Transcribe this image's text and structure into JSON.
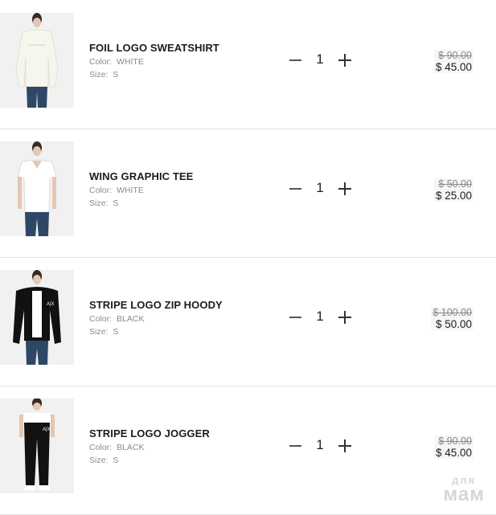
{
  "cart": {
    "items": [
      {
        "name": "FOIL LOGO SWEATSHIRT",
        "color_label": "Color:",
        "color": "WHITE",
        "size_label": "Size:",
        "size": "S",
        "quantity": "1",
        "price_original": "$ 90.00",
        "price_sale": "$ 45.00",
        "image_icon": "white-sweatshirt-model-image"
      },
      {
        "name": "WING GRAPHIC TEE",
        "color_label": "Color:",
        "color": "WHITE",
        "size_label": "Size:",
        "size": "S",
        "quantity": "1",
        "price_original": "$ 50.00",
        "price_sale": "$ 25.00",
        "image_icon": "white-tee-model-image"
      },
      {
        "name": "STRIPE LOGO ZIP HOODY",
        "color_label": "Color:",
        "color": "BLACK",
        "size_label": "Size:",
        "size": "S",
        "quantity": "1",
        "price_original": "$ 100.00",
        "price_sale": "$ 50.00",
        "image_icon": "black-hoody-model-image"
      },
      {
        "name": "STRIPE LOGO JOGGER",
        "color_label": "Color:",
        "color": "BLACK",
        "size_label": "Size:",
        "size": "S",
        "quantity": "1",
        "price_original": "$ 90.00",
        "price_sale": "$ 45.00",
        "image_icon": "black-jogger-model-image"
      }
    ]
  },
  "watermark": {
    "top": "для",
    "bottom": "мам"
  },
  "colors": {
    "text_dark": "#1c1c1c",
    "text_muted": "#8a8a8a",
    "divider": "#e2e2e2",
    "price_bg": "#f6f6f6"
  }
}
